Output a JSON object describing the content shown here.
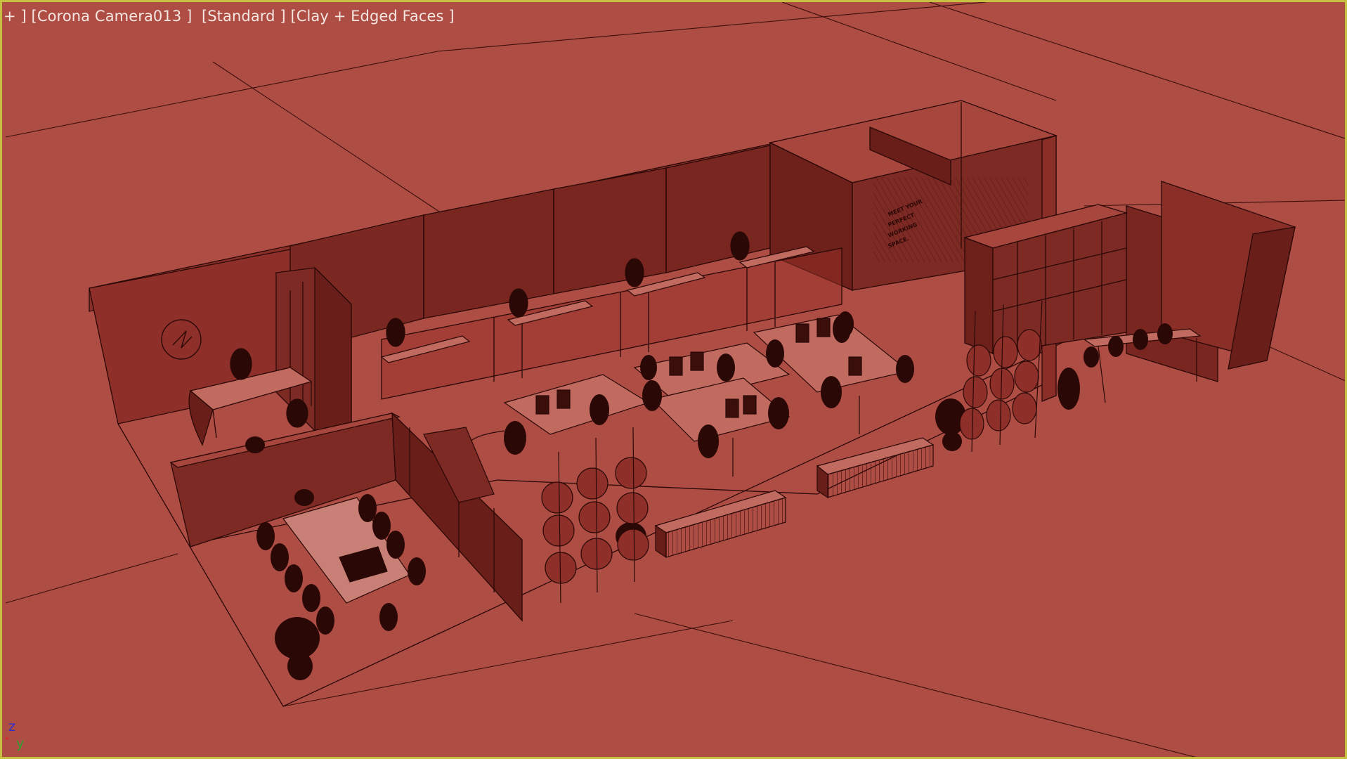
{
  "viewport": {
    "menu_plus": "+ ]",
    "camera": "[Corona Camera013 ]",
    "shading_mode": "[Standard ]",
    "display_mode": "[Clay + Edged Faces ]",
    "border_color": "#c8c040",
    "clay_color": "#ae4d44"
  },
  "axis_gizmo": {
    "z_label": "z",
    "y_label": "y"
  },
  "scene": {
    "wall_sign_lines": [
      "MEET YOUR",
      "PERFECT",
      "WORKING",
      "SPACE."
    ]
  }
}
